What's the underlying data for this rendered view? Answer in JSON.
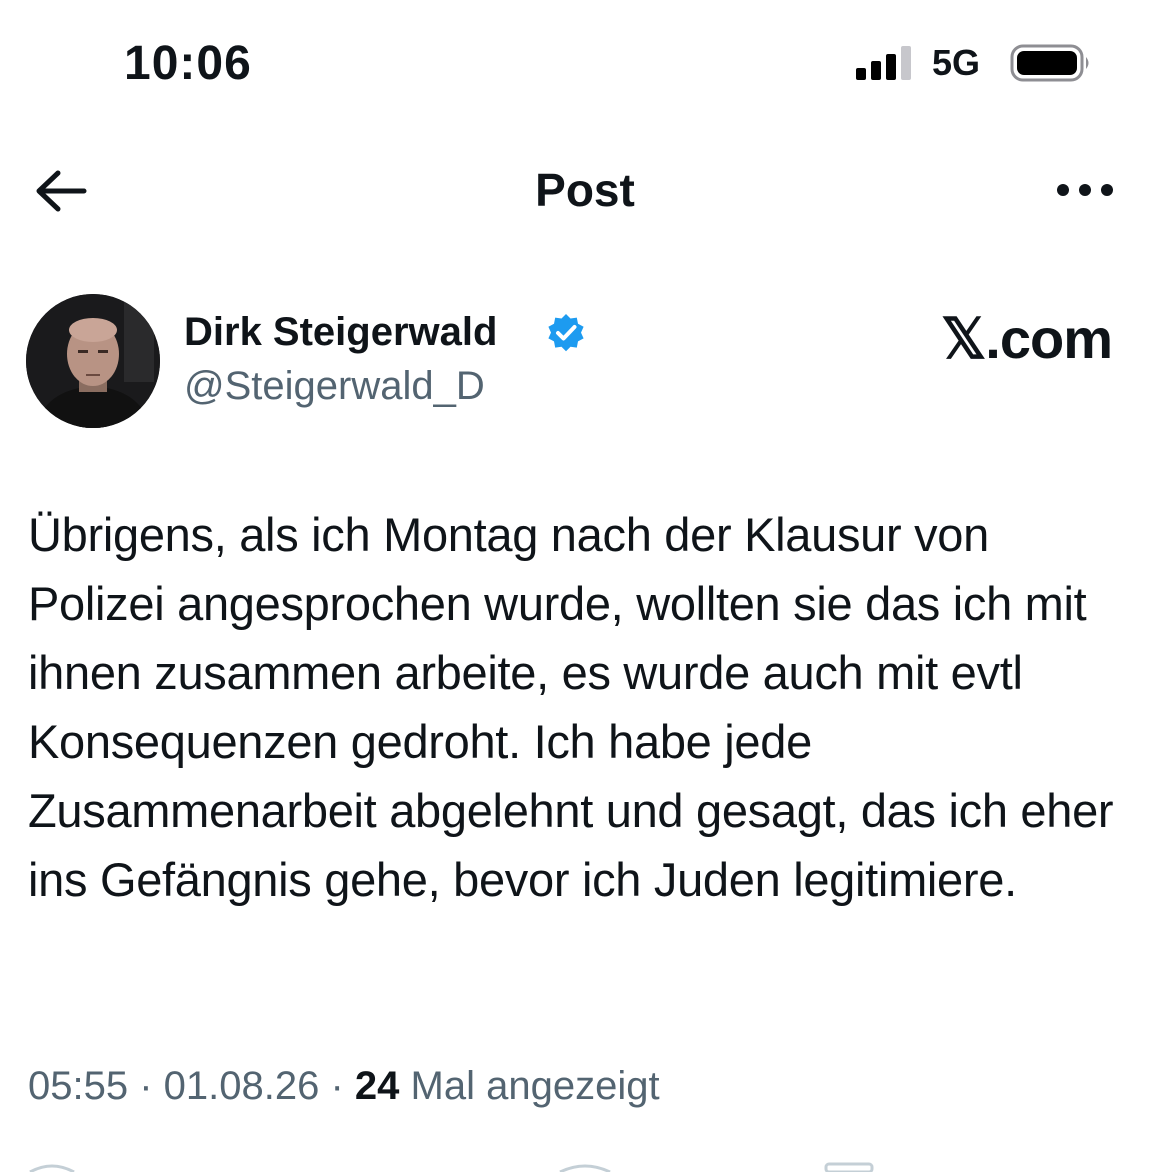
{
  "status_bar": {
    "time": "10:06",
    "network": "5G",
    "icons": [
      "signal-bars-icon",
      "battery-icon"
    ]
  },
  "nav": {
    "title": "Post",
    "icons": [
      "back-arrow-icon",
      "more-options-icon"
    ]
  },
  "author": {
    "name": "Dirk Steigerwald",
    "handle": "@Steigerwald_D",
    "verified_color": "#1d9bf0",
    "icons": [
      "avatar",
      "verified-badge-icon"
    ]
  },
  "brand": "𝕏.com",
  "tweet": {
    "text": "Übrigens, als ich Montag nach der Klausur von Polizei angesprochen wurde, wollten sie das ich mit ihnen zusammen arbeite, es wurde auch mit evtl Konsequenzen gedroht. Ich habe jede Zusammenarbeit abgelehnt und gesagt, das ich eher ins Gefängnis gehe, bevor ich Juden legitimiere."
  },
  "meta": {
    "time": "05:55",
    "separator": " · ",
    "date": "01.08.26",
    "views_count": "24",
    "views_label": " Mal angezeigt"
  },
  "colors": {
    "text": "#0f1419",
    "secondary": "#536471",
    "accent": "#1d9bf0"
  }
}
